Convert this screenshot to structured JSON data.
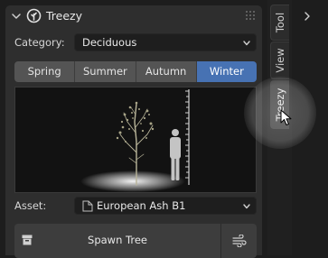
{
  "panel": {
    "title": "Treezy",
    "category": {
      "label": "Category:",
      "value": "Deciduous"
    },
    "seasons": [
      {
        "label": "Spring",
        "active": false
      },
      {
        "label": "Summer",
        "active": false
      },
      {
        "label": "Autumn",
        "active": false
      },
      {
        "label": "Winter",
        "active": true
      }
    ],
    "asset": {
      "label": "Asset:",
      "value": "European Ash B1"
    },
    "spawn_label": "Spawn Tree"
  },
  "sidebar": {
    "tabs": [
      {
        "label": "Tool",
        "active": false
      },
      {
        "label": "View",
        "active": false
      },
      {
        "label": "Treezy",
        "active": true
      }
    ]
  },
  "colors": {
    "accent": "#4772b3",
    "panel_bg": "#2e2e2e",
    "button_bg": "#545454",
    "field_bg": "#1e1e1e"
  }
}
